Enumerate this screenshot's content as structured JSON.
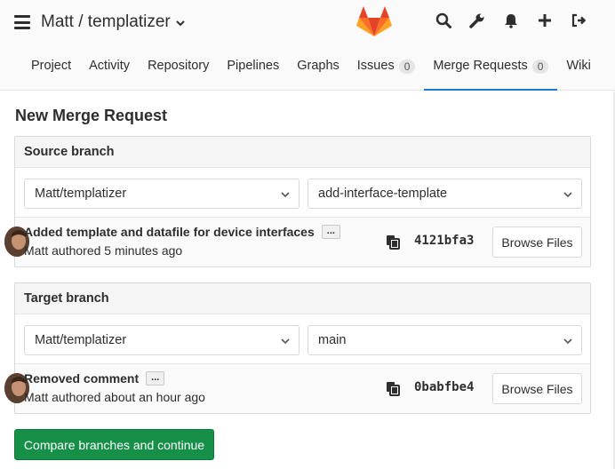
{
  "header": {
    "project_title": "Matt / templatizer",
    "icons": [
      "menu-icon",
      "search-icon",
      "wrench-icon",
      "bell-icon",
      "plus-icon",
      "sign-out-icon"
    ]
  },
  "nav": {
    "tabs": [
      {
        "label": "Project"
      },
      {
        "label": "Activity"
      },
      {
        "label": "Repository"
      },
      {
        "label": "Pipelines"
      },
      {
        "label": "Graphs"
      },
      {
        "label": "Issues",
        "count": "0"
      },
      {
        "label": "Merge Requests",
        "count": "0",
        "active": true
      },
      {
        "label": "Wiki"
      }
    ]
  },
  "page": {
    "title": "New Merge Request"
  },
  "source": {
    "heading": "Source branch",
    "project": "Matt/templatizer",
    "branch": "add-interface-template",
    "commit_title": "Added template and datafile for device interfaces",
    "ellipsis": "...",
    "commit_meta": "Matt authored 5 minutes ago",
    "sha": "4121bfa3",
    "browse_label": "Browse Files"
  },
  "target": {
    "heading": "Target branch",
    "project": "Matt/templatizer",
    "branch": "main",
    "commit_title": "Removed comment",
    "ellipsis": "...",
    "commit_meta": "Matt authored about an hour ago",
    "sha": "0babfbe4",
    "browse_label": "Browse Files"
  },
  "actions": {
    "compare_label": "Compare branches and continue"
  },
  "colors": {
    "accent": "#1f78d1",
    "success": "#168f48",
    "logo_orange": "#fc6d26",
    "logo_red": "#e24329",
    "logo_light": "#fca326"
  }
}
